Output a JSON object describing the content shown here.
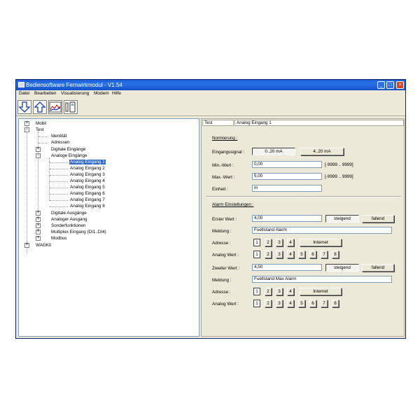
{
  "window": {
    "title": "Bediensoftware Fernwirkmodul - V1.54"
  },
  "menu": [
    "Datei",
    "Bearbeiten",
    "Visualisierung",
    "Modem",
    "Hilfe"
  ],
  "tree": {
    "mobil": "Mobil",
    "test": "Test",
    "identitaet": "Identität",
    "adressen": "Adressen",
    "digitale_eingaenge": "Digitale Eingänge",
    "analoge_eingaenge": "Analoge Eingänge",
    "analog_eingaenge": [
      "Analog Eingang 1",
      "Analog Eingang 2",
      "Analog Eingang 3",
      "Analog Eingang 4",
      "Analog Eingang 5",
      "Analog Eingang 6",
      "Analog Eingang 7",
      "Analog Eingang 8"
    ],
    "digitale_ausgaenge": "Digitale Ausgänge",
    "analoger_ausgang": "Analoger Ausgang",
    "sonderfunktionen": "Sonderfunktionen",
    "multiplex": "Multiplex Eingang (DI1..DI4)",
    "modbus": "Modbus",
    "wagkit": "WAGKit"
  },
  "header": {
    "col1": "Test",
    "col2": "Analog Eingang 1"
  },
  "normierung": {
    "title": "Normierung :",
    "eingangssignal_label": "Eingangssignal :",
    "opt1": "0..20 mA",
    "opt2": "4..20 mA",
    "min_label": "Min.-Wert :",
    "min_value": "0,00",
    "min_range": "[-9999 .. 9999]",
    "max_label": "Max.-Wert :",
    "max_value": "5,00",
    "max_range": "[-9999 .. 9999]",
    "einheit_label": "Einheit :",
    "einheit_value": "m"
  },
  "alarm": {
    "title": "Alarm Einstellungen :",
    "erster_label": "Erster Wert :",
    "erster_value": "4,00",
    "zweiter_label": "Zweiter Wert :",
    "zweiter_value": "4,50",
    "steigend": "steigend",
    "fallend": "fallend",
    "meldung_label": "Meldung :",
    "meldung1": "Fuellstand Alarm",
    "meldung2": "Fuellstand Max Alarm",
    "adresse_label": "Adresse :",
    "adresse_buttons": [
      "1",
      "2",
      "3",
      "4"
    ],
    "internet": "Internet",
    "analog_label": "Analog Wert :",
    "analog_buttons": [
      "1",
      "2",
      "3",
      "4",
      "5",
      "6",
      "7",
      "8"
    ]
  }
}
